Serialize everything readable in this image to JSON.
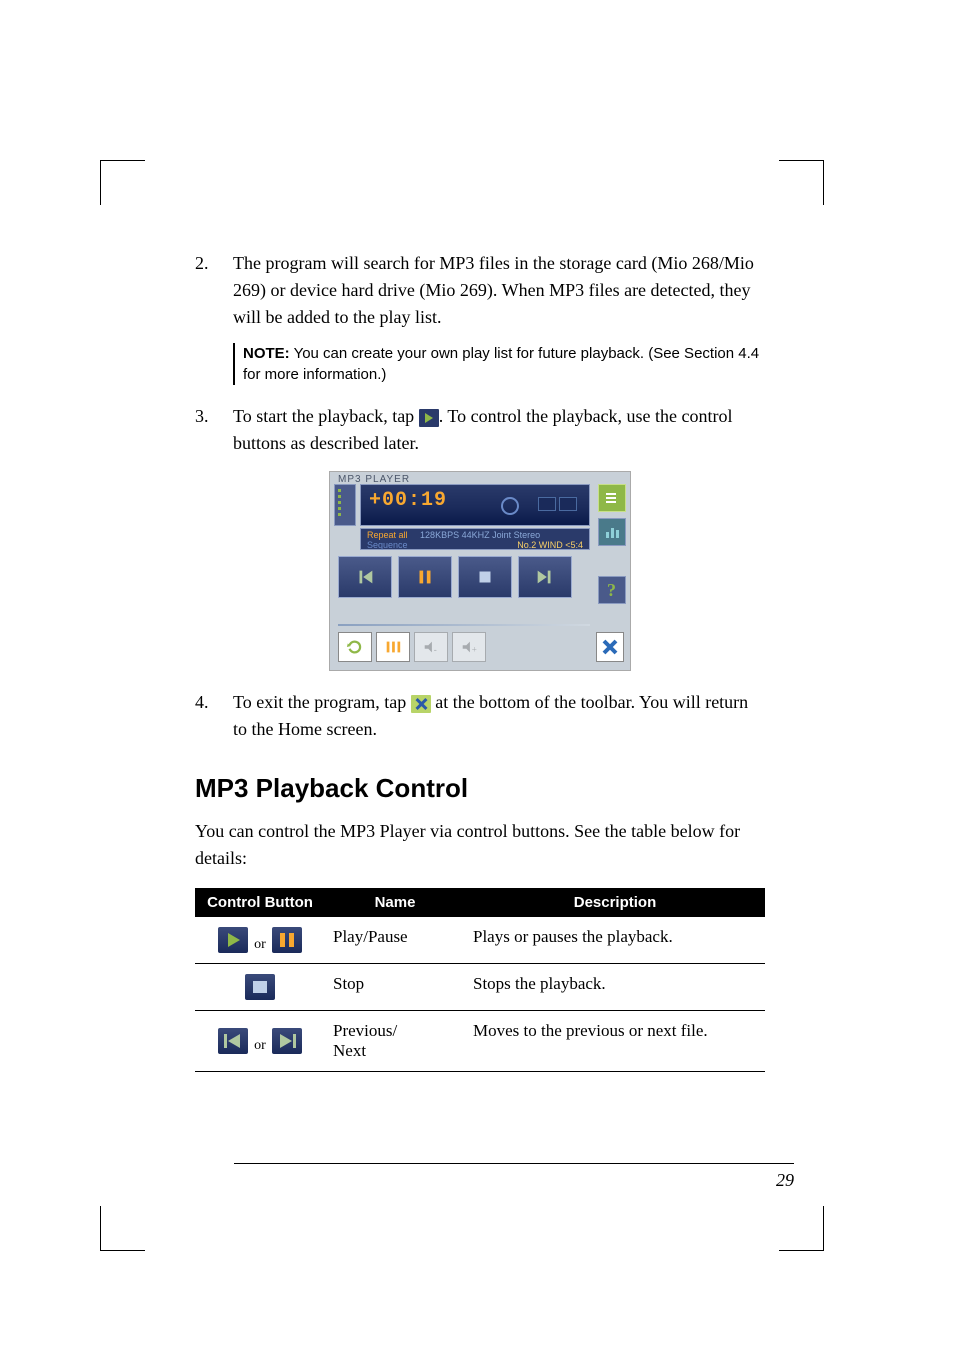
{
  "list_item_2": {
    "number": "2.",
    "text": "The program will search for MP3 files in the storage card (Mio 268/Mio 269) or device hard drive (Mio 269). When MP3 files are detected, they will be added to the play list."
  },
  "note": {
    "label": "NOTE:",
    "text": " You can create your own play list for future playback. (See Section 4.4 for more information.)"
  },
  "list_item_3": {
    "number": "3.",
    "text_before": "To start the playback, tap ",
    "text_after": ". To control the playback, use the control buttons as described later."
  },
  "player": {
    "title": "MP3 PLAYER",
    "time": "+00:19",
    "repeat": "Repeat all",
    "sequence": "Sequence",
    "bitrate": "128KBPS 44KHZ Joint Stereo",
    "track": "No.2   WIND <5:4"
  },
  "list_item_4": {
    "number": "4.",
    "text_before": "To exit the program, tap ",
    "text_after": " at the bottom of the toolbar. You will return to the Home screen."
  },
  "heading": "MP3 Playback Control",
  "intro_text": "You can control the MP3 Player via control buttons. See the table below for details:",
  "table": {
    "headers": [
      "Control Button",
      "Name",
      "Description"
    ],
    "rows": [
      {
        "button": "play_pause",
        "name": "Play/Pause",
        "desc": "Plays or pauses the playback."
      },
      {
        "button": "stop",
        "name": "Stop",
        "desc": "Stops the playback."
      },
      {
        "button": "prev_next",
        "name": "Previous/\nNext",
        "desc": "Moves to the previous or next file."
      }
    ]
  },
  "or_text": "or",
  "page_number": "29"
}
